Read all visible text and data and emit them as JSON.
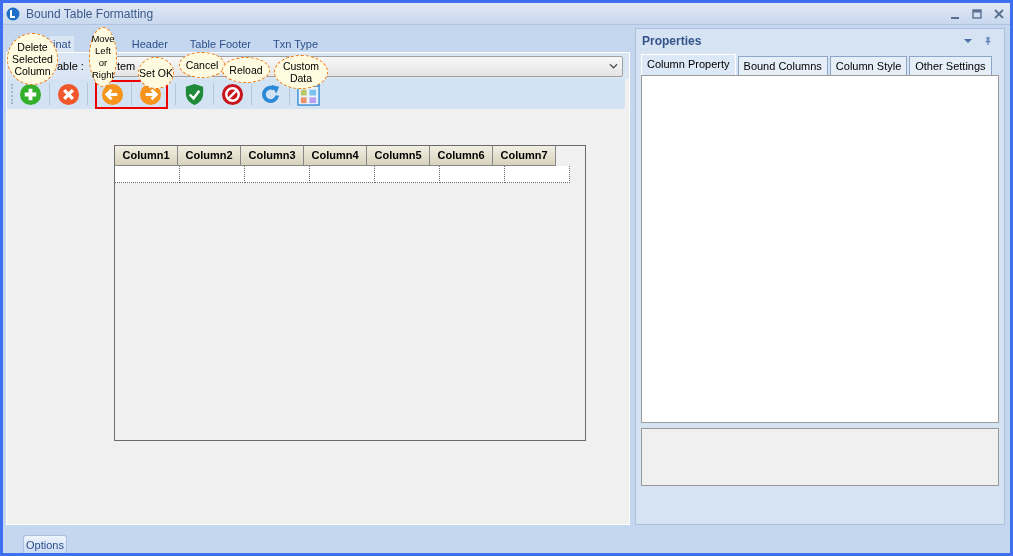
{
  "window": {
    "title": "Bound Table Formatting"
  },
  "tabs": [
    {
      "label": "inat",
      "selected": true
    },
    {
      "label": "Header",
      "selected": false
    },
    {
      "label": "Table Footer",
      "selected": false
    },
    {
      "label": "Txn Type",
      "selected": false
    }
  ],
  "table_field": {
    "label": "able :",
    "value": "tem"
  },
  "toolbar": [
    {
      "kind": "add",
      "outlined": false
    },
    {
      "kind": "delete",
      "outlined": false
    },
    {
      "kind": "left",
      "outlined": true
    },
    {
      "kind": "right",
      "outlined": true
    },
    {
      "kind": "ok",
      "outlined": false
    },
    {
      "kind": "cancel",
      "outlined": false
    },
    {
      "kind": "reload",
      "outlined": false
    },
    {
      "kind": "custom",
      "outlined": false
    }
  ],
  "callouts": [
    {
      "text": "Delete Selected Column",
      "kind": "delete"
    },
    {
      "text": "Move Left or Right",
      "kind": "move"
    },
    {
      "text": "Set OK",
      "kind": "ok"
    },
    {
      "text": "Cancel",
      "kind": "cancel"
    },
    {
      "text": "Reload",
      "kind": "reload"
    },
    {
      "text": "Custom Data",
      "kind": "custom"
    }
  ],
  "table": {
    "columns": [
      "Column1",
      "Column2",
      "Column3",
      "Column4",
      "Column5",
      "Column6",
      "Column7"
    ]
  },
  "properties": {
    "title": "Properties",
    "tabs": [
      {
        "label": "Column Property",
        "selected": true
      },
      {
        "label": "Bound Columns",
        "selected": false
      },
      {
        "label": "Column Style",
        "selected": false
      },
      {
        "label": "Other Settings",
        "selected": false
      }
    ]
  },
  "bottom_tabs": [
    {
      "label": "Options",
      "selected": true
    }
  ]
}
